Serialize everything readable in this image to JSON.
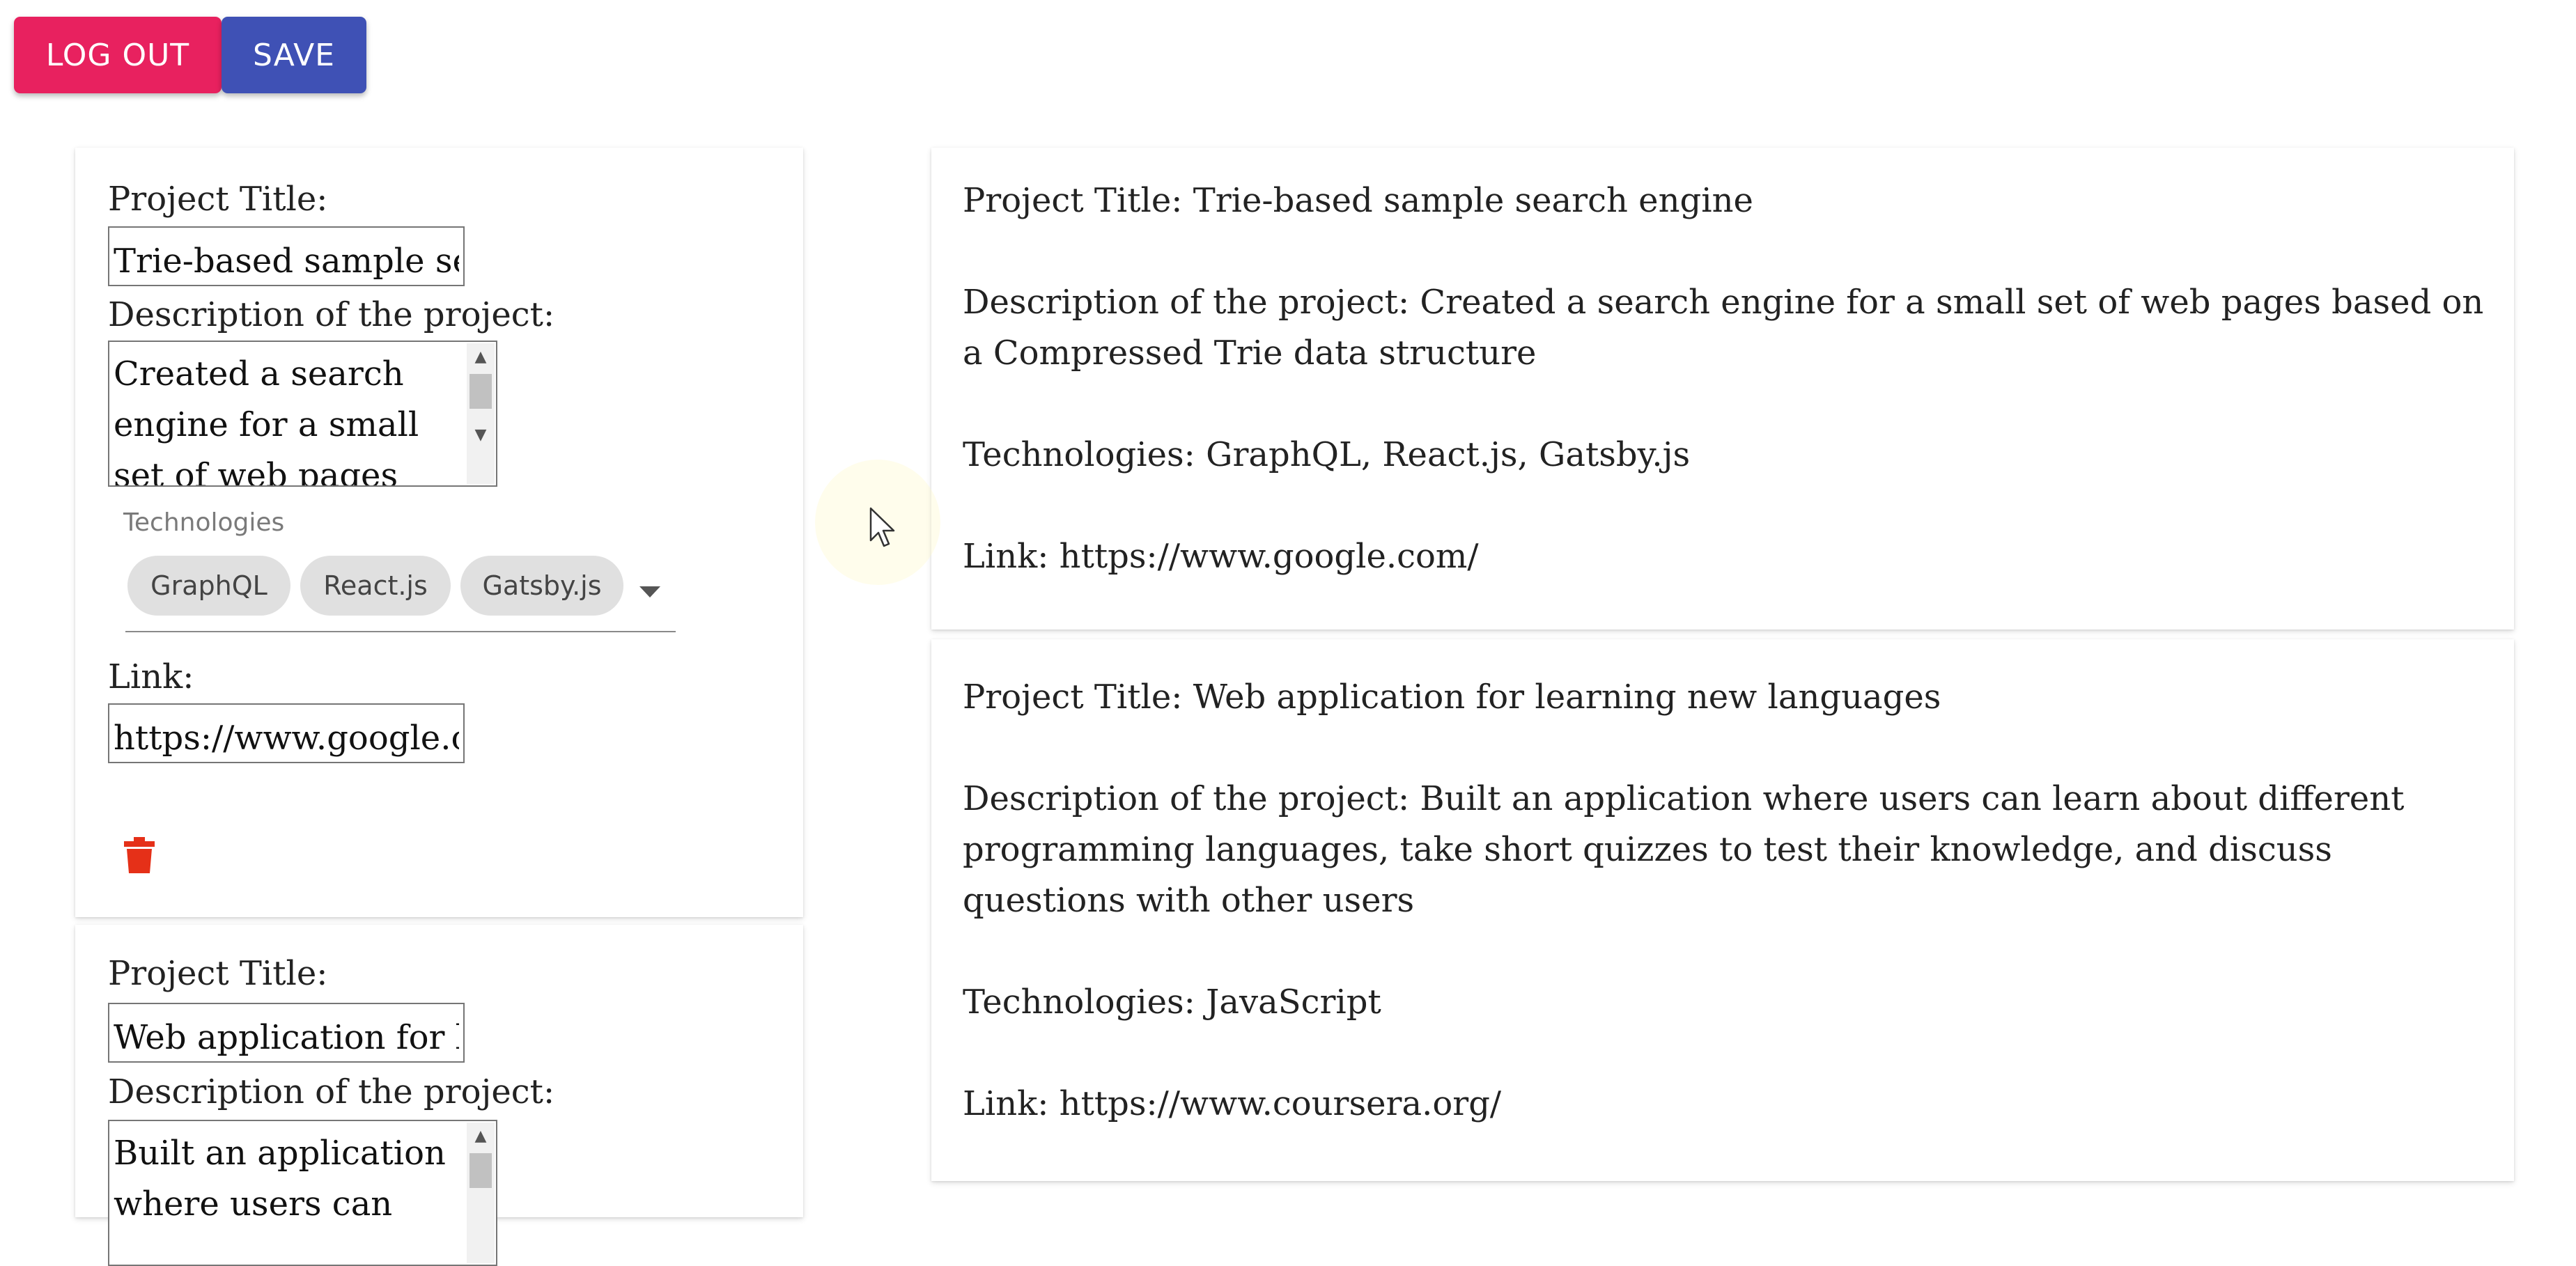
{
  "toolbar": {
    "logout_label": "LOG OUT",
    "save_label": "SAVE"
  },
  "labels": {
    "project_title": "Project Title:",
    "description": "Description of the project:",
    "technologies": "Technologies",
    "link": "Link:"
  },
  "edit_projects": [
    {
      "title_value": "Trie-based sample sea",
      "description_value": "Created a search engine for a small set of web pages based on",
      "technologies": [
        "GraphQL",
        "React.js",
        "Gatsby.js"
      ],
      "link_value": "https://www.google.co"
    },
    {
      "title_value": "Web application for le",
      "description_value": "Built an application where users can"
    }
  ],
  "preview_projects": [
    {
      "title": "Project Title: Trie-based sample search engine",
      "description": "Description of the project: Created a search engine for a small set of web pages based on a Compressed Trie data structure",
      "technologies": "Technologies: GraphQL, React.js, Gatsby.js",
      "link": "Link: https://www.google.com/"
    },
    {
      "title": "Project Title: Web application for learning new languages",
      "description": "Description of the project: Built an application where users can learn about different programming languages, take short quizzes to test their knowledge, and discuss questions with other users",
      "technologies": "Technologies: JavaScript",
      "link": "Link: https://www.coursera.org/"
    }
  ],
  "icons": {
    "delete": "trash-icon",
    "dropdown": "arrow-drop-down-icon",
    "cursor": "mouse-pointer-icon"
  },
  "colors": {
    "logout": "#e8215f",
    "save": "#3f51b5",
    "delete": "#e53018"
  }
}
